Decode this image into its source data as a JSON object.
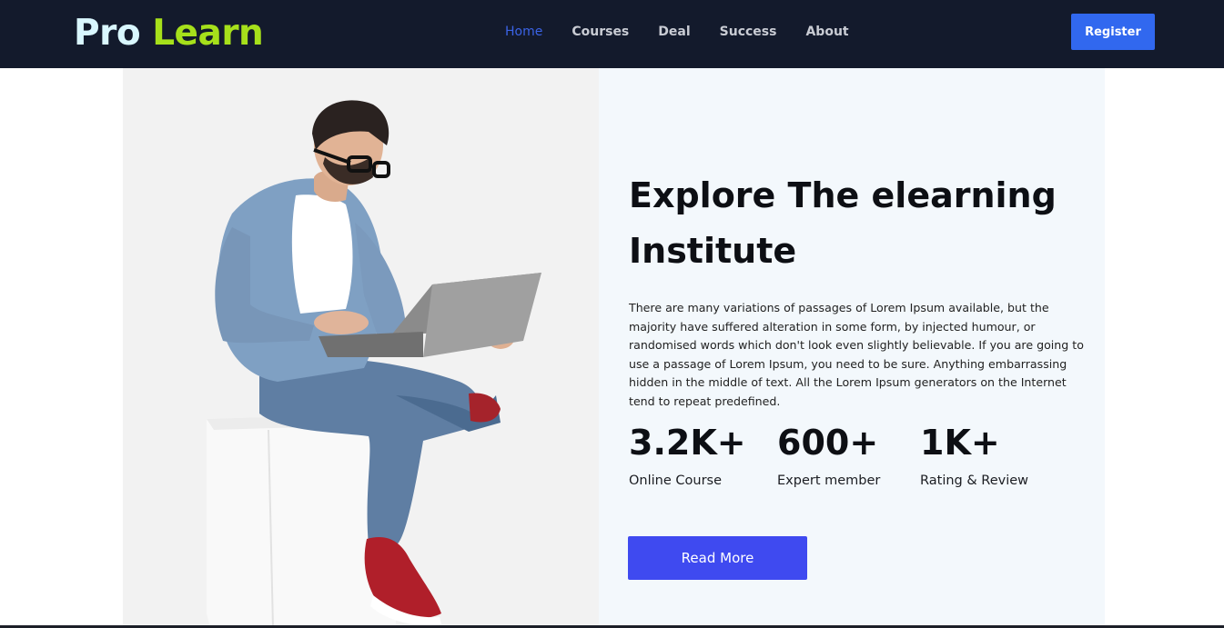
{
  "brand": {
    "word1": "Pro",
    "word2": "Learn",
    "color1": "#d9f7ff",
    "color2": "#a6e01b"
  },
  "nav": {
    "items": [
      {
        "label": "Home",
        "active": true
      },
      {
        "label": "Courses",
        "active": false
      },
      {
        "label": "Deal",
        "active": false
      },
      {
        "label": "Success",
        "active": false
      },
      {
        "label": "About",
        "active": false
      }
    ],
    "register_label": "Register"
  },
  "hero": {
    "title": "Explore The elearning Institute",
    "description": "There are many variations of passages of Lorem Ipsum available, but the majority have suffered alteration in some form, by injected humour, or randomised words which don't look even slightly believable. If you are going to use a passage of Lorem Ipsum, you need to be sure. Anything embarrassing hidden in the middle of text. All the Lorem Ipsum generators on the Internet tend to repeat predefined.",
    "stats": [
      {
        "value": "3.2K+",
        "label": "Online Course"
      },
      {
        "value": "600+",
        "label": "Expert member"
      },
      {
        "value": "1K+",
        "label": "Rating & Review"
      }
    ],
    "cta_label": "Read More"
  },
  "colors": {
    "navbar_bg": "#131a2c",
    "accent": "#3168ef",
    "cta": "#3f4af0",
    "content_bg": "#f3f8fc"
  }
}
